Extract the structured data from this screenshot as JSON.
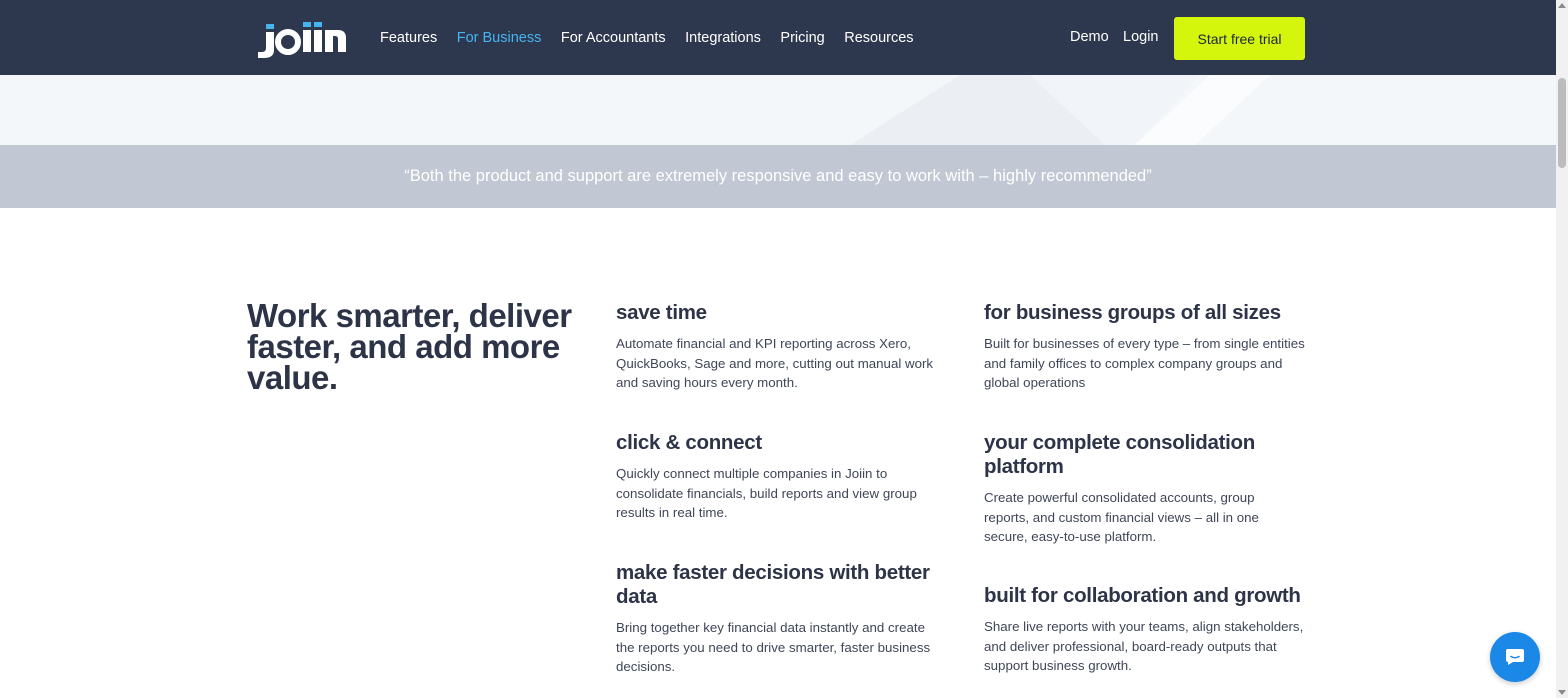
{
  "header": {
    "logo_alt": "joiin",
    "nav": [
      {
        "label": "Features",
        "active": false
      },
      {
        "label": "For Business",
        "active": true
      },
      {
        "label": "For Accountants",
        "active": false
      },
      {
        "label": "Integrations",
        "active": false
      },
      {
        "label": "Pricing",
        "active": false
      },
      {
        "label": "Resources",
        "active": false
      }
    ],
    "demo_label": "Demo",
    "login_label": "Login",
    "cta_label": "Start free trial"
  },
  "testimonial": {
    "quote": "“Both the product and support are extremely responsive and easy to work with – highly recommended”"
  },
  "main": {
    "headline": "Work smarter, deliver faster, and add more value.",
    "features": [
      {
        "title": "save time",
        "text": "Automate financial and KPI reporting across Xero, QuickBooks, Sage and more, cutting out manual work and saving hours every month."
      },
      {
        "title": "for business groups of all sizes",
        "text": "Built for businesses of every type – from single entities and family offices to complex company groups and global operations"
      },
      {
        "title": "click & connect",
        "text": "Quickly connect multiple companies in Joiin to consolidate financials, build reports and view group results in real time."
      },
      {
        "title": "your complete consolidation platform",
        "text": "Create powerful consolidated accounts, group reports, and custom financial views – all in one secure, easy-to-use platform."
      },
      {
        "title": "make faster decisions with better data",
        "text": "Bring together key financial data instantly and create the reports you need to drive smarter, faster business decisions."
      },
      {
        "title": "built for collaboration and growth",
        "text": "Share live reports with your teams, align stakeholders, and deliver professional, board-ready outputs that support business growth."
      }
    ]
  },
  "colors": {
    "header_bg": "#2d374d",
    "accent_blue": "#45b4f1",
    "cta_bg": "#d4f50c",
    "quote_band_bg": "#c1c7d3",
    "chat_bg": "#1b87e6"
  }
}
